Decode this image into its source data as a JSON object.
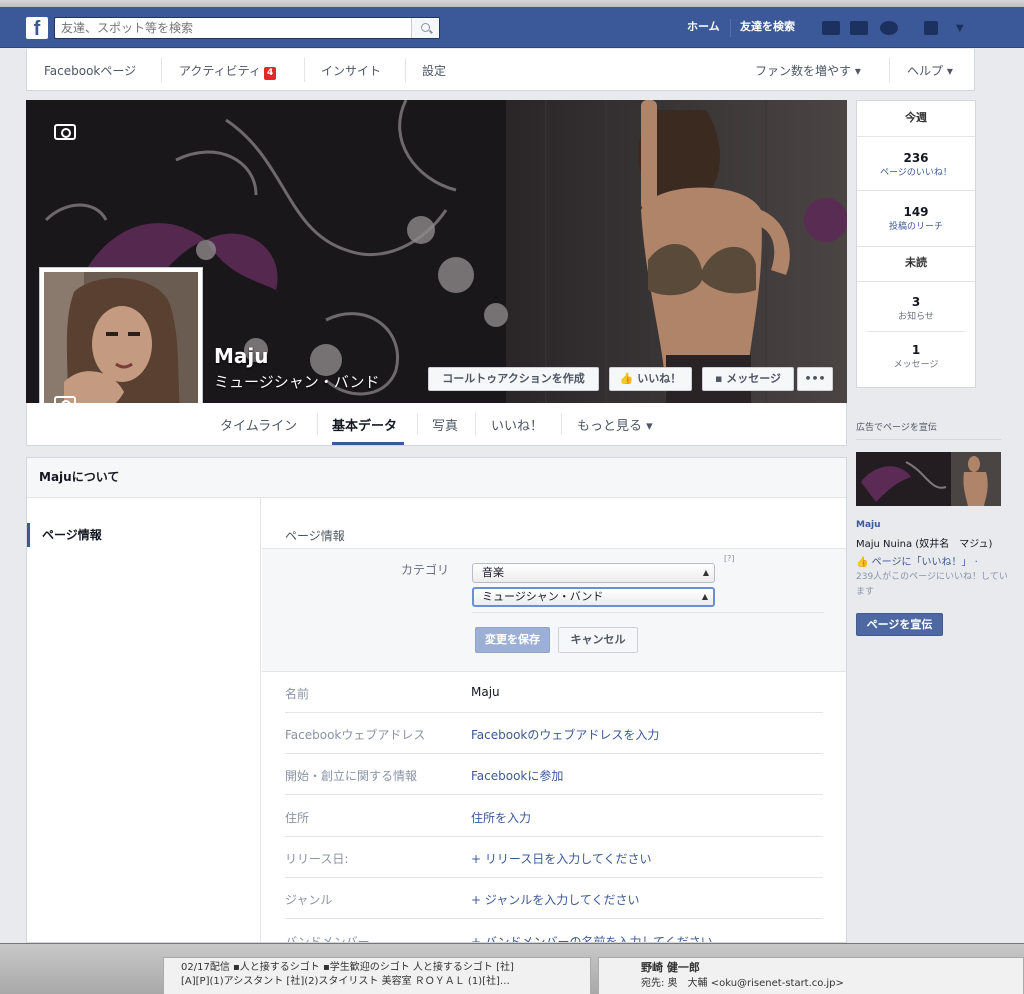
{
  "header": {
    "search_placeholder": "友達、スポット等を検索",
    "home": "ホーム",
    "find_friends": "友達を検索"
  },
  "page_nav": {
    "facebook_page": "Facebookページ",
    "activity": "アクティビティ",
    "activity_badge": "4",
    "insights": "インサイト",
    "settings": "設定",
    "grow_fans": "ファン数を増やす ▾",
    "help": "ヘルプ ▾"
  },
  "profile": {
    "name": "Maju",
    "category": "ミュージシャン・バンド",
    "cta_button": "コールトゥアクションを作成",
    "like_button": "いいね！",
    "message_button": "メッセージ",
    "more_button": "•••"
  },
  "tabs": [
    "タイムライン",
    "基本データ",
    "写真",
    "いいね！",
    "もっと見る ▾"
  ],
  "this_week": {
    "header": "今週",
    "page_likes_count": "236",
    "page_likes_label": "ページのいいね！",
    "post_reach_count": "149",
    "post_reach_label": "投稿のリーチ",
    "unread_header": "未読",
    "notifications_count": "3",
    "notifications_label": "お知らせ",
    "messages_count": "1",
    "messages_label": "メッセージ"
  },
  "about": {
    "title": "Majuについて",
    "nav_item": "ページ情報",
    "section_title": "ページ情報",
    "category_label": "カテゴリ",
    "category_select_1": "音楽",
    "category_select_2": "ミュージシャン・バンド",
    "help_mark": "[?]",
    "save_button": "変更を保存",
    "cancel_button": "キャンセル",
    "rows": [
      {
        "label": "名前",
        "value": "Maju"
      },
      {
        "label": "Facebookウェブアドレス",
        "value": "Facebookのウェブアドレスを入力"
      },
      {
        "label": "開始・創立に関する情報",
        "value": "Facebookに参加"
      },
      {
        "label": "住所",
        "value": "住所を入力"
      },
      {
        "label": "リリース日:",
        "value": "+ リリース日を入力してください"
      },
      {
        "label": "ジャンル",
        "value": "+ ジャンルを入力してください"
      },
      {
        "label": "バンドメンバー",
        "value": "+ バンドメンバーの名前を入力してください"
      }
    ]
  },
  "ad": {
    "title": "広告でページを宣伝",
    "page_name": "Maju",
    "subtitle": "Maju Nuina (奴井名　マジュ)",
    "like_text": "ページに「いいね！」 ·",
    "like_count_text": "239人がこのページにいいね！しています",
    "promote_button": "ページを宣伝"
  },
  "mail": {
    "line1": "02/17配信 ▪人と接するシゴト ▪学生歓迎のシゴト 人と接するシゴト [社]",
    "line2": "[A][P](1)アシスタント [社](2)スタイリスト 美容室 ＲＯＹＡＬ (1)[社]…",
    "sender": "野崎 健一郎",
    "to": "宛先: 奥　大輔 <oku@risenet-start.co.jp>"
  },
  "colors": {
    "brand_blue": "#3b5998",
    "page_bg": "#e9eaed",
    "badge_red": "#e02a2a"
  }
}
